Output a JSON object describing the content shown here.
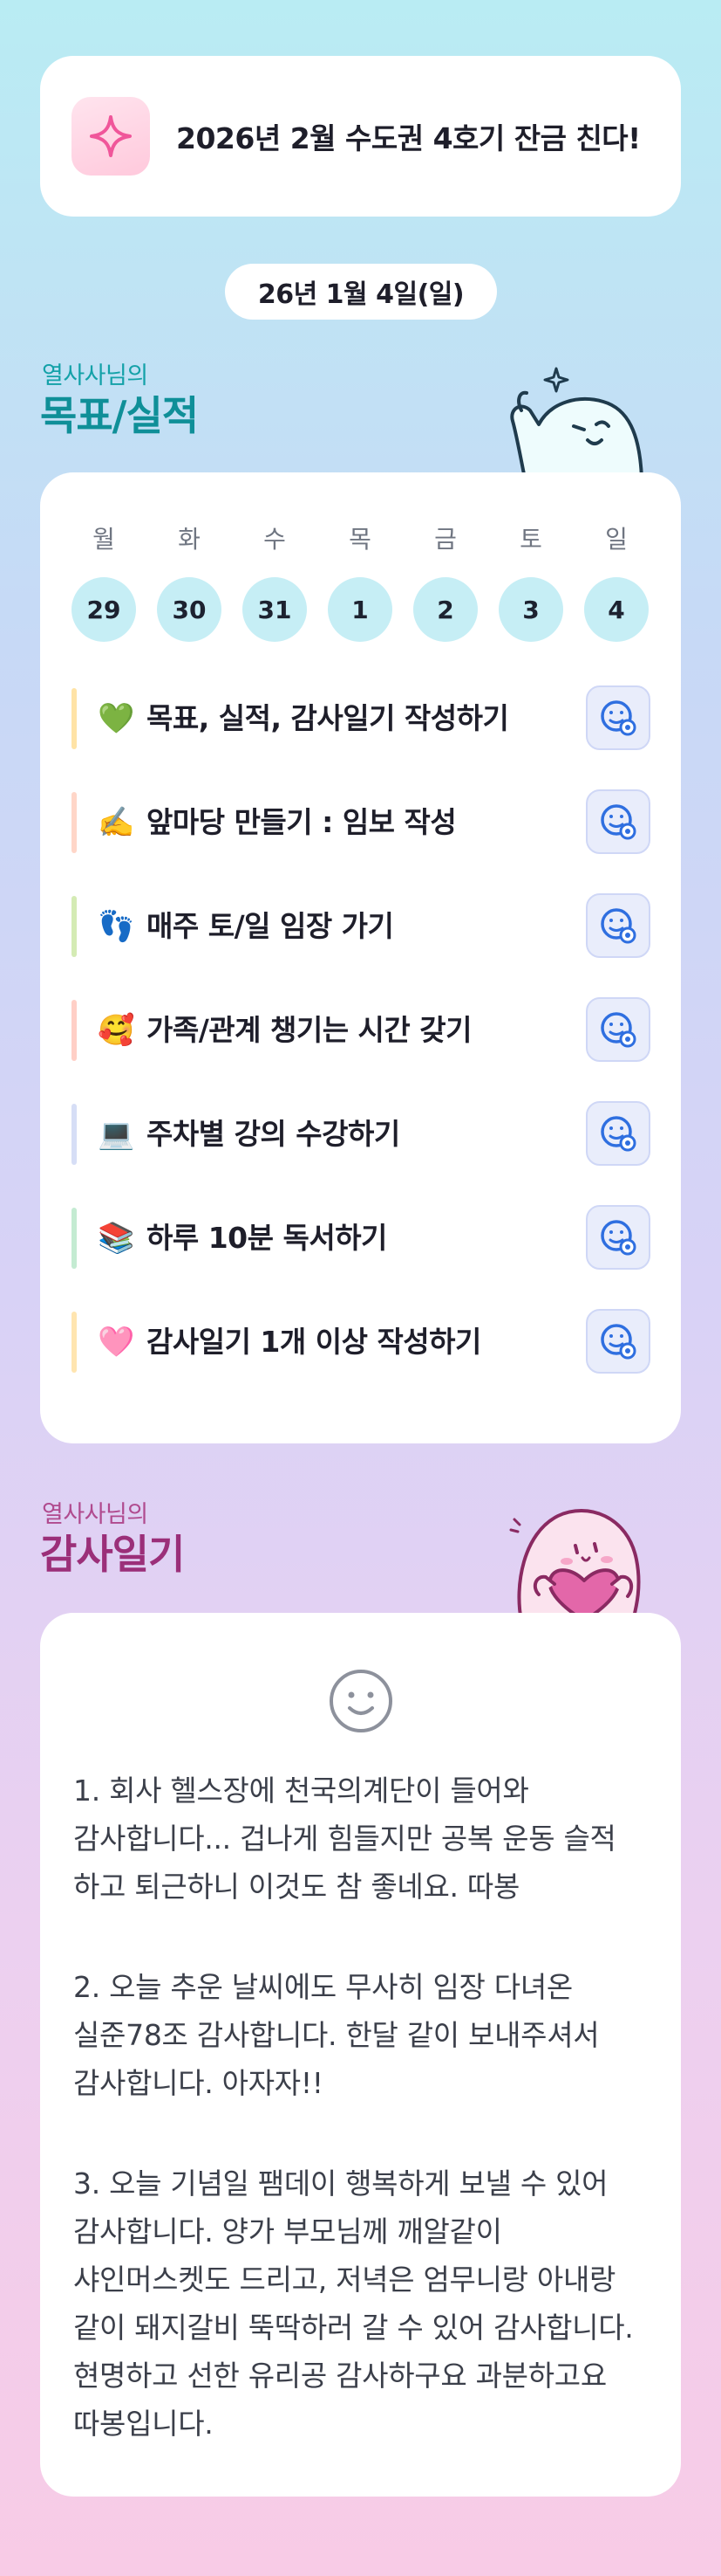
{
  "banner": {
    "title": "2026년 2월 수도권 4호기 잔금 친다!",
    "icon": "sparkle-icon"
  },
  "date": "26년 1월 4일(일)",
  "goals_section": {
    "subtitle": "열사사님의",
    "title": "목표/실적"
  },
  "week": {
    "days": [
      "월",
      "화",
      "수",
      "목",
      "금",
      "토",
      "일"
    ],
    "dates": [
      "29",
      "30",
      "31",
      "1",
      "2",
      "3",
      "4"
    ]
  },
  "goals": [
    {
      "emoji": "💚",
      "text": "목표, 실적, 감사일기 작성하기",
      "bar_color": "#ffe3a6"
    },
    {
      "emoji": "✍️",
      "text": "앞마당 만들기 : 임보 작성",
      "bar_color": "#ffd6c8"
    },
    {
      "emoji": "👣",
      "text": "매주 토/일 임장 가기",
      "bar_color": "#d4ebb4"
    },
    {
      "emoji": "🥰",
      "text": "가족/관계 챙기는 시간 갖기",
      "bar_color": "#ffcfc6"
    },
    {
      "emoji": "💻",
      "text": "주차별 강의 수강하기",
      "bar_color": "#d6def6"
    },
    {
      "emoji": "📚",
      "text": "하루 10분 독서하기",
      "bar_color": "#c4ebd2"
    },
    {
      "emoji": "🩷",
      "text": "감사일기 1개 이상 작성하기",
      "bar_color": "#ffe5b0"
    }
  ],
  "diary_section": {
    "subtitle": "열사사님의",
    "title": "감사일기"
  },
  "diary": {
    "entries": [
      "1. 회사 헬스장에 천국의계단이 들어와 감사합니다... 겁나게 힘들지만 공복 운동 슬적 하고 퇴근하니 이것도 참 좋네요. 따봉",
      "2. 오늘 추운 날씨에도 무사히 임장 다녀온 실준78조 감사합니다. 한달 같이 보내주셔서 감사합니다. 아자자!!",
      "3. 오늘 기념일 팸데이 행복하게 보낼 수 있어 감사합니다. 양가 부모님께 깨알같이 샤인머스켓도 드리고, 저녁은 엄무니랑 아내랑 같이 돼지갈비 뚝딱하러 갈 수 있어 감사합니다. 현명하고 선한 유리공 감사하구요 과분하고요 따봉입니다."
    ]
  },
  "colors": {
    "accent_teal": "#0f8f98",
    "accent_magenta": "#9b2f79",
    "check_blue": "#2f6fe0",
    "day_circle": "#c6eef5"
  }
}
